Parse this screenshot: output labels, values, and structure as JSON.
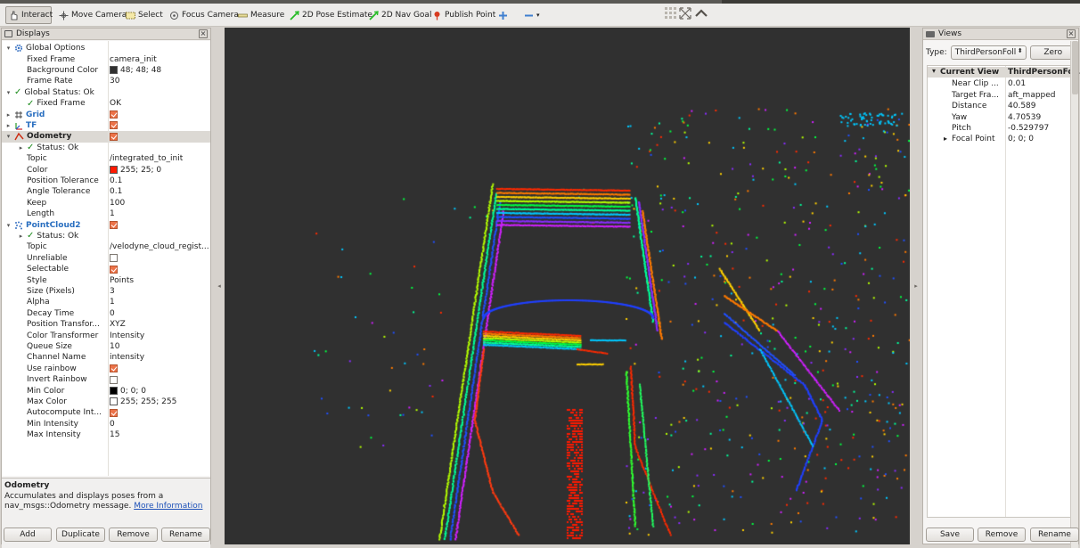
{
  "toolbar": {
    "tools": [
      {
        "label": "Interact",
        "icon": "hand-pointer-icon",
        "active": true
      },
      {
        "label": "Move Camera",
        "icon": "move-camera-icon",
        "active": false
      },
      {
        "label": "Select",
        "icon": "select-box-icon",
        "active": false
      },
      {
        "label": "Focus Camera",
        "icon": "focus-camera-icon",
        "active": false
      },
      {
        "label": "Measure",
        "icon": "ruler-icon",
        "active": false
      },
      {
        "label": "2D Pose Estimate",
        "icon": "green-arrow-icon",
        "active": false
      },
      {
        "label": "2D Nav Goal",
        "icon": "green-arrow-icon",
        "active": false
      },
      {
        "label": "Publish Point",
        "icon": "red-pin-icon",
        "active": false
      }
    ]
  },
  "displays": {
    "title": "Displays",
    "rows": [
      {
        "indent": 0,
        "arrow": "▾",
        "icon": "gear-icon",
        "name": "Global Options",
        "value": ""
      },
      {
        "indent": 1,
        "arrow": "",
        "icon": "",
        "name": "Fixed Frame",
        "value": "camera_init"
      },
      {
        "indent": 1,
        "arrow": "",
        "icon": "",
        "name": "Background Color",
        "value": "48; 48; 48",
        "swatch": "#303030"
      },
      {
        "indent": 1,
        "arrow": "",
        "icon": "",
        "name": "Frame Rate",
        "value": "30"
      },
      {
        "indent": 0,
        "arrow": "▾",
        "icon": "check-icon",
        "name": "Global Status: Ok",
        "value": ""
      },
      {
        "indent": 1,
        "arrow": "",
        "icon": "check-icon",
        "name": "Fixed Frame",
        "value": "OK",
        "bold": false
      },
      {
        "indent": 0,
        "arrow": "▸",
        "icon": "grid-icon",
        "name": "Grid",
        "value": "",
        "checkbox": true,
        "blue": true
      },
      {
        "indent": 0,
        "arrow": "▸",
        "icon": "tf-icon",
        "name": "TF",
        "value": "",
        "checkbox": true,
        "blue": true
      },
      {
        "indent": 0,
        "arrow": "▾",
        "icon": "odometry-icon",
        "name": "Odometry",
        "value": "",
        "checkbox": true,
        "bold": true,
        "selected": true
      },
      {
        "indent": 1,
        "arrow": "▸",
        "icon": "check-icon",
        "name": "Status: Ok",
        "value": ""
      },
      {
        "indent": 1,
        "arrow": "",
        "icon": "",
        "name": "Topic",
        "value": "/integrated_to_init"
      },
      {
        "indent": 1,
        "arrow": "",
        "icon": "",
        "name": "Color",
        "value": "255; 25; 0",
        "swatch": "#ff1900"
      },
      {
        "indent": 1,
        "arrow": "",
        "icon": "",
        "name": "Position Tolerance",
        "value": "0.1"
      },
      {
        "indent": 1,
        "arrow": "",
        "icon": "",
        "name": "Angle Tolerance",
        "value": "0.1"
      },
      {
        "indent": 1,
        "arrow": "",
        "icon": "",
        "name": "Keep",
        "value": "100"
      },
      {
        "indent": 1,
        "arrow": "",
        "icon": "",
        "name": "Length",
        "value": "1"
      },
      {
        "indent": 0,
        "arrow": "▾",
        "icon": "pointcloud-icon",
        "name": "PointCloud2",
        "value": "",
        "checkbox": true,
        "blue": true
      },
      {
        "indent": 1,
        "arrow": "▸",
        "icon": "check-icon",
        "name": "Status: Ok",
        "value": ""
      },
      {
        "indent": 1,
        "arrow": "",
        "icon": "",
        "name": "Topic",
        "value": "/velodyne_cloud_regist..."
      },
      {
        "indent": 1,
        "arrow": "",
        "icon": "",
        "name": "Unreliable",
        "value": "",
        "checkbox": false
      },
      {
        "indent": 1,
        "arrow": "",
        "icon": "",
        "name": "Selectable",
        "value": "",
        "checkbox": true
      },
      {
        "indent": 1,
        "arrow": "",
        "icon": "",
        "name": "Style",
        "value": "Points"
      },
      {
        "indent": 1,
        "arrow": "",
        "icon": "",
        "name": "Size (Pixels)",
        "value": "3"
      },
      {
        "indent": 1,
        "arrow": "",
        "icon": "",
        "name": "Alpha",
        "value": "1"
      },
      {
        "indent": 1,
        "arrow": "",
        "icon": "",
        "name": "Decay Time",
        "value": "0"
      },
      {
        "indent": 1,
        "arrow": "",
        "icon": "",
        "name": "Position Transfor...",
        "value": "XYZ"
      },
      {
        "indent": 1,
        "arrow": "",
        "icon": "",
        "name": "Color Transformer",
        "value": "Intensity"
      },
      {
        "indent": 1,
        "arrow": "",
        "icon": "",
        "name": "Queue Size",
        "value": "10"
      },
      {
        "indent": 1,
        "arrow": "",
        "icon": "",
        "name": "Channel Name",
        "value": "intensity"
      },
      {
        "indent": 1,
        "arrow": "",
        "icon": "",
        "name": "Use rainbow",
        "value": "",
        "checkbox": true
      },
      {
        "indent": 1,
        "arrow": "",
        "icon": "",
        "name": "Invert Rainbow",
        "value": "",
        "checkbox": false
      },
      {
        "indent": 1,
        "arrow": "",
        "icon": "",
        "name": "Min Color",
        "value": "0; 0; 0",
        "swatch": "#000000"
      },
      {
        "indent": 1,
        "arrow": "",
        "icon": "",
        "name": "Max Color",
        "value": "255; 255; 255",
        "swatch": "#ffffff"
      },
      {
        "indent": 1,
        "arrow": "",
        "icon": "",
        "name": "Autocompute Int...",
        "value": "",
        "checkbox": true
      },
      {
        "indent": 1,
        "arrow": "",
        "icon": "",
        "name": "Min Intensity",
        "value": "0"
      },
      {
        "indent": 1,
        "arrow": "",
        "icon": "",
        "name": "Max Intensity",
        "value": "15"
      }
    ],
    "description": {
      "title": "Odometry",
      "text": "Accumulates and displays poses from a nav_msgs::Odometry message.",
      "link": "More Information"
    },
    "buttons": {
      "add": "Add",
      "duplicate": "Duplicate",
      "remove": "Remove",
      "rename": "Rename"
    }
  },
  "views": {
    "title": "Views",
    "type_label": "Type:",
    "type_value": "ThirdPersonFoll",
    "zero_button": "Zero",
    "header": {
      "name": "Current View",
      "value": "ThirdPersonFoll..."
    },
    "rows": [
      {
        "name": "Near Clip ...",
        "value": "0.01",
        "arrow": ""
      },
      {
        "name": "Target Fra...",
        "value": "aft_mapped",
        "arrow": ""
      },
      {
        "name": "Distance",
        "value": "40.589",
        "arrow": ""
      },
      {
        "name": "Yaw",
        "value": "4.70539",
        "arrow": ""
      },
      {
        "name": "Pitch",
        "value": "-0.529797",
        "arrow": ""
      },
      {
        "name": "Focal Point",
        "value": "0; 0; 0",
        "arrow": "▸"
      }
    ],
    "buttons": {
      "save": "Save",
      "remove": "Remove",
      "rename": "Rename"
    }
  },
  "viewport": {
    "background": "#303030",
    "trajectory_color": "#ff1900"
  }
}
